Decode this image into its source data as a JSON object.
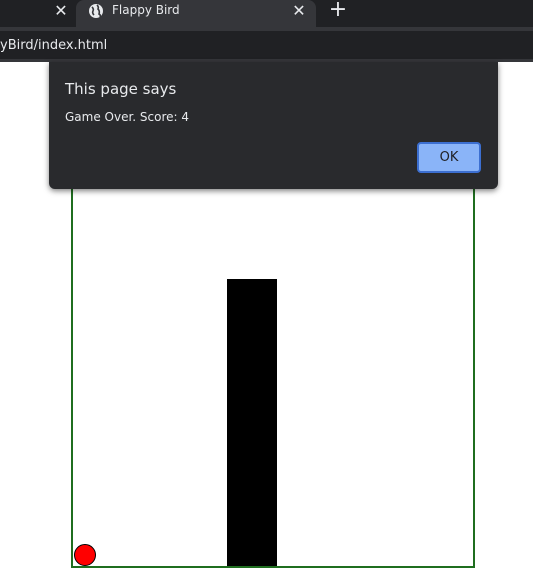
{
  "browser": {
    "tab_title": "Flappy Bird",
    "close_glyph": "✕",
    "new_tab_glyph": "+",
    "url": "yBird/index.html"
  },
  "dialog": {
    "title": "This page says",
    "message": "Game Over. Score: 4",
    "ok_label": "OK"
  },
  "game": {
    "score": 4,
    "colors": {
      "border": "#1f6e1f",
      "pipe": "#000000",
      "bird": "#ff0000",
      "background": "#ffffff"
    }
  },
  "theme": {
    "tabstrip": "#202124",
    "toolbar": "#35363a",
    "dialog_bg": "#292a2d",
    "button": "#8ab4f8"
  }
}
